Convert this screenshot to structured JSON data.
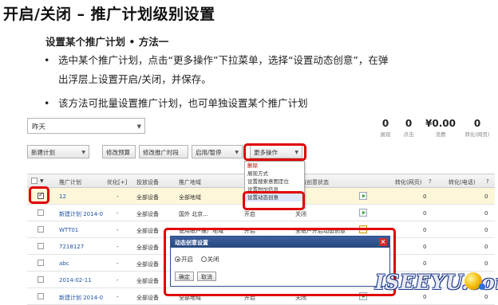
{
  "slide": {
    "title": "开启/关闭 – 推广计划级别设置",
    "subtitle": "设置某个推广计划 • 方法一",
    "bullet1": "选中某个推广计划，点击“更多操作”下拉菜单，选择“设置动态创意”，在弹",
    "bullet1_cont": "出浮层上设置开启/关闭，并保存。",
    "bullet2": "该方法可批量设置推广计划，也可单独设置某个推广计划",
    "bullet_symbol": "•"
  },
  "ui": {
    "date_select": "昨天",
    "stats": [
      {
        "value": "0",
        "label": "展现"
      },
      {
        "value": "0",
        "label": "点击"
      },
      {
        "value": "¥0.00",
        "label": "消费"
      },
      {
        "value": "0",
        "label": "转化(网页)"
      }
    ],
    "toolbar": {
      "new_plan": "新建计划",
      "edit_budget": "修改预算",
      "edit_time": "修改推广时段",
      "enable_pause": "启用/暂停",
      "more_actions": "更多操作"
    },
    "more_menu": {
      "items": [
        "删除",
        "展现方式",
        "设置搜索意图定位",
        "设置附加信息",
        "设置动态创意"
      ]
    },
    "table": {
      "headers": {
        "plan": "推广计划",
        "optimize": "优化[+]",
        "device": "投放设备",
        "region": "推广地域",
        "status": "推",
        "creative": "动态创意状态",
        "conv_web": "转化(网页)",
        "conv_phone": "转化(电话)",
        "help": "?"
      },
      "rows": [
        {
          "name": "12",
          "optimize": "-",
          "device": "全部设备",
          "region": "全部地域",
          "status": "",
          "creative": "",
          "conv_web": "0",
          "conv_phone": "0",
          "checked": true,
          "icon": "go"
        },
        {
          "name": "新建计划 2014-0",
          "optimize": "-",
          "device": "全部设备",
          "region": "国外 北京...",
          "status": "开启",
          "creative": "关闭",
          "conv_web": "0",
          "conv_phone": "0",
          "checked": false,
          "icon": "go"
        },
        {
          "name": "WTT01",
          "optimize": "-",
          "device": "全部设备",
          "region": "使用账户推广地域",
          "status": "开启",
          "creative": "全账户开启动态创意",
          "conv_web": "0",
          "conv_phone": "0",
          "checked": false,
          "icon": "pause"
        },
        {
          "name": "7218127",
          "optimize": "-",
          "device": "全部设备",
          "region": "",
          "status": "",
          "creative": "",
          "conv_web": "0",
          "conv_phone": "0",
          "checked": false,
          "icon": ""
        },
        {
          "name": "abc",
          "optimize": "-",
          "device": "全部设备",
          "region": "",
          "status": "",
          "creative": "",
          "conv_web": "0",
          "conv_phone": "0",
          "checked": false,
          "icon": ""
        },
        {
          "name": "2014-02-11",
          "optimize": "-",
          "device": "全部设备",
          "region": "",
          "status": "",
          "creative": "",
          "conv_web": "0",
          "conv_phone": "0",
          "checked": false,
          "icon": ""
        },
        {
          "name": "新建计划 2014-0",
          "optimize": "-",
          "device": "全部设备",
          "region": "全部地域",
          "status": "开启",
          "creative": "关闭",
          "conv_web": "0",
          "conv_phone": "0",
          "checked": false,
          "icon": "go"
        }
      ]
    },
    "dialog": {
      "title": "动态创意设置",
      "close": "×",
      "option_on": "开启",
      "option_off": "关闭",
      "confirm": "确定",
      "cancel": "取消"
    }
  },
  "watermark": {
    "text": "ISEEYU.com"
  },
  "colors": {
    "highlight_red": "#e00000",
    "link_blue": "#1f52a4",
    "dialog_header": "#2b4e8c"
  }
}
